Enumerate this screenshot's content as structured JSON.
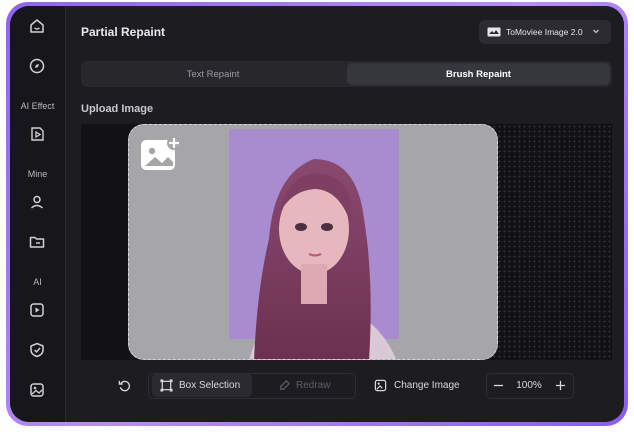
{
  "sidebar": {
    "sections": [
      {
        "label": "AI Effect"
      },
      {
        "label": "Mine"
      },
      {
        "label": "AI"
      }
    ],
    "icons": [
      "home-icon",
      "explore-icon",
      "ai-effect-icon",
      "profile-icon",
      "folder-icon",
      "ai-video-icon",
      "ai-repair-icon",
      "ai-image-icon"
    ]
  },
  "header": {
    "title": "Partial Repaint",
    "model": "ToMoviee Image 2.0"
  },
  "tabs": [
    {
      "label": "Text Repaint",
      "active": false
    },
    {
      "label": "Brush Repaint",
      "active": true
    }
  ],
  "upload": {
    "label": "Upload Image"
  },
  "toolbar": {
    "box_selection": "Box Selection",
    "redraw": "Redraw",
    "change_image": "Change Image",
    "zoom": "100%"
  },
  "colors": {
    "accent_frame": "#9b6ef3",
    "background": "#1d1d21",
    "active_tab": "#36363d"
  }
}
